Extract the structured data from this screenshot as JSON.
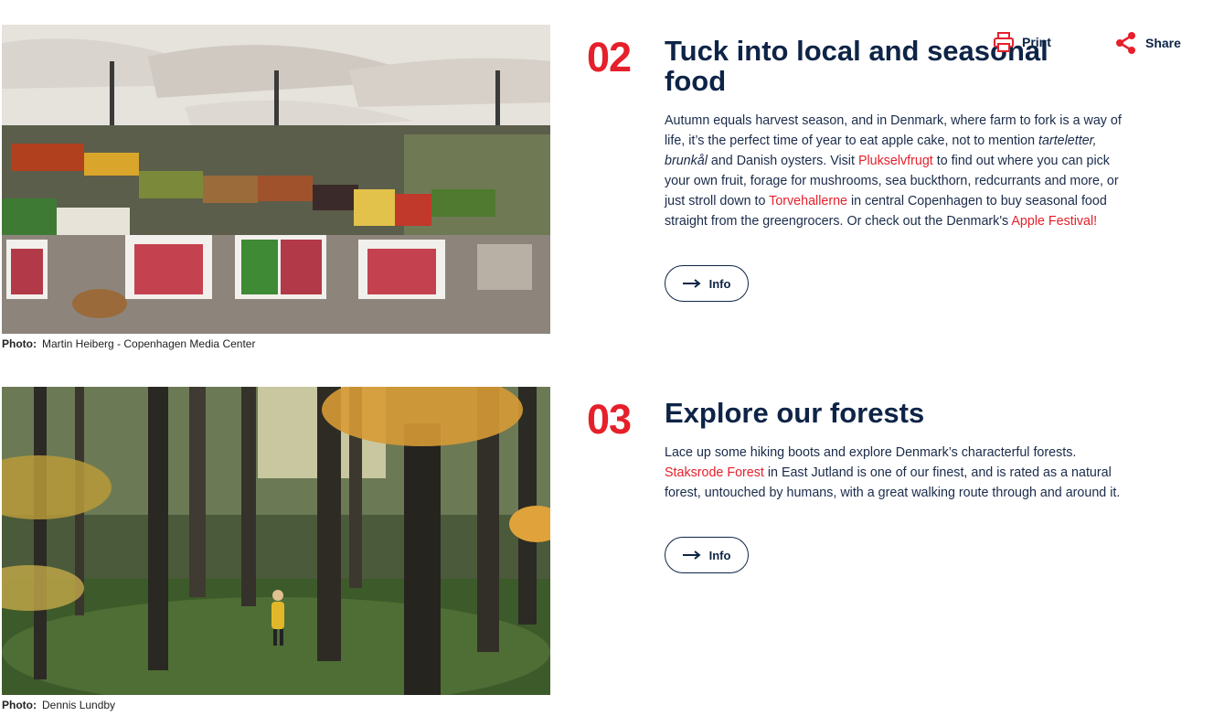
{
  "toolbar": {
    "print_label": "Print",
    "share_label": "Share"
  },
  "sections": [
    {
      "number": "02",
      "title": "Tuck into local and seasonal food",
      "body": {
        "t1": "Autumn equals harvest season, and in Denmark, where farm to fork is a way of life, it’s the perfect time of year to eat apple cake, not to mention ",
        "italic": "tarteletter, brunkål",
        "t2": " and Danish oysters. Visit ",
        "link1": "Plukselvfrugt",
        "t3": " to find out where you can pick your own fruit, forage for mushrooms, sea buckthorn, redcurrants and more, or just stroll down to ",
        "link2": "Torvehallerne",
        "t4": " in central Copenhagen to buy seasonal food straight from the greengrocers. Or check out the Denmark's ",
        "link3": "Apple Festival!"
      },
      "button_label": "Info",
      "photo_label": "Photo:",
      "photo_credit": "Martin Heiberg - Copenhagen Media Center"
    },
    {
      "number": "03",
      "title": "Explore our forests",
      "body": {
        "t1": "Lace up some hiking boots and explore Denmark’s characterful forests. ",
        "link1": "Staksrode Forest",
        "t2": " in East Jutland is one of our finest, and is rated as a natural forest, untouched by humans, with a great walking route through and around it."
      },
      "button_label": "Info",
      "photo_label": "Photo:",
      "photo_credit": "Dennis Lundby"
    }
  ],
  "colors": {
    "accent": "#e5202b",
    "navy": "#0e2447"
  }
}
